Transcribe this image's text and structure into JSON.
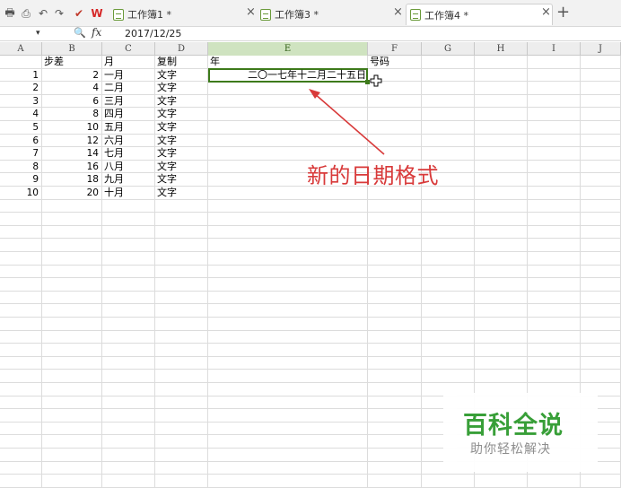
{
  "tabs": [
    {
      "label": "工作簿1 *",
      "close": "×",
      "active": false
    },
    {
      "label": "工作簿3 *",
      "close": "×",
      "active": false
    },
    {
      "label": "工作簿4 *",
      "close": "×",
      "active": true
    }
  ],
  "new_tab": "+",
  "formula_bar": {
    "fx_label": "fx",
    "value": "2017/12/25"
  },
  "columns": [
    "A",
    "B",
    "C",
    "D",
    "E",
    "F",
    "G",
    "H",
    "I",
    "J"
  ],
  "selected_column": "E",
  "header_row": {
    "B": "步差",
    "C": "月",
    "D": "复制",
    "E": "年",
    "F": "号码"
  },
  "rows": [
    {
      "a": "1",
      "b": "2",
      "c": "一月",
      "d": "文字"
    },
    {
      "a": "2",
      "b": "4",
      "c": "二月",
      "d": "文字"
    },
    {
      "a": "3",
      "b": "6",
      "c": "三月",
      "d": "文字"
    },
    {
      "a": "4",
      "b": "8",
      "c": "四月",
      "d": "文字"
    },
    {
      "a": "5",
      "b": "10",
      "c": "五月",
      "d": "文字"
    },
    {
      "a": "6",
      "b": "12",
      "c": "六月",
      "d": "文字"
    },
    {
      "a": "7",
      "b": "14",
      "c": "七月",
      "d": "文字"
    },
    {
      "a": "8",
      "b": "16",
      "c": "八月",
      "d": "文字"
    },
    {
      "a": "9",
      "b": "18",
      "c": "九月",
      "d": "文字"
    },
    {
      "a": "10",
      "b": "20",
      "c": "十月",
      "d": "文字"
    }
  ],
  "active_cell_value": "二〇一七年十二月二十五日",
  "annotation": "新的日期格式",
  "watermark": {
    "main": "百科全说",
    "sub": "助你轻松解决"
  },
  "colors": {
    "accent": "#3d7a1b",
    "annotation": "#d83a3a",
    "watermark": "#2e9a2e"
  }
}
